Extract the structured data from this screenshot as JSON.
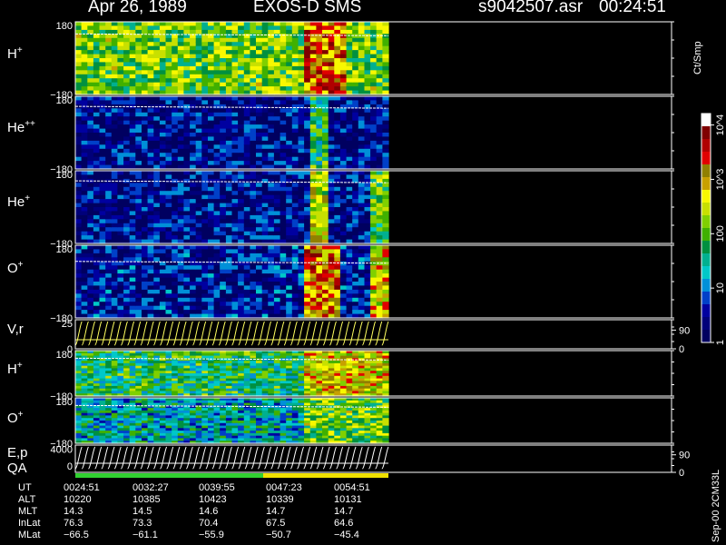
{
  "header": {
    "date": "Apr 26, 1989",
    "instrument": "EXOS-D SMS",
    "filename": "s9042507.asr",
    "time": "00:24:51"
  },
  "colorbar": {
    "unit": "Ct/Smp",
    "tick_labels": [
      {
        "text": "1",
        "value": 1
      },
      {
        "text": "10",
        "value": 10
      },
      {
        "text": "100",
        "value": 100
      },
      {
        "text": "10^3",
        "value": 1000
      },
      {
        "text": "10^4",
        "value": 10000
      }
    ],
    "colors": [
      "#000060",
      "#00007a",
      "#0000a0",
      "#0040c8",
      "#0090d8",
      "#00c8c8",
      "#00b090",
      "#009040",
      "#40b000",
      "#80d000",
      "#c8e000",
      "#f8f800",
      "#c8a000",
      "#908000",
      "#e00000",
      "#b00000",
      "#800000",
      "#ffffff"
    ]
  },
  "footer_side_text": "Sep-00 2CM33L",
  "time_table": {
    "row_labels": [
      "UT",
      "ALT",
      "MLT",
      "InLat",
      "MLat"
    ],
    "columns": [
      [
        "0024:51",
        "10220",
        "14.3",
        "76.3",
        "−66.5"
      ],
      [
        "0032:27",
        "10385",
        "14.5",
        "73.3",
        "−61.1"
      ],
      [
        "0039:55",
        "10423",
        "14.6",
        "70.4",
        "−55.9"
      ],
      [
        "0047:23",
        "10339",
        "14.7",
        "67.5",
        "−50.7"
      ],
      [
        "0054:51",
        "10131",
        "14.7",
        "64.6",
        "−45.4"
      ]
    ]
  },
  "quality_bar": [
    {
      "label": "",
      "start": 0,
      "end": 0.6,
      "color": "#30d030"
    },
    {
      "label": "",
      "start": 0.6,
      "end": 1.0,
      "color": "#f0e000"
    }
  ],
  "chart_data": [
    {
      "type": "heatmap",
      "panel": "H+ angle",
      "ylabel_main": "H",
      "ylabel_sup": "+",
      "yticks": [
        {
          "text": "180",
          "value": 180
        },
        {
          "text": "−180",
          "value": -180
        }
      ],
      "ylim": [
        -180,
        180
      ],
      "x_frac_range": [
        0,
        0.59
      ],
      "bursts": [
        {
          "start": 0.72,
          "end": 0.85,
          "level": 0.85
        }
      ],
      "base_level": 0.55,
      "line_value": 120
    },
    {
      "type": "heatmap",
      "panel": "He++ angle",
      "ylabel_main": "He",
      "ylabel_sup": "++",
      "yticks": [
        {
          "text": "180",
          "value": 180
        },
        {
          "text": "−180",
          "value": -180
        }
      ],
      "ylim": [
        -180,
        180
      ],
      "x_frac_range": [
        0,
        0.59
      ],
      "bursts": [
        {
          "start": 0.74,
          "end": 0.8,
          "level": 0.45
        }
      ],
      "base_level": 0.12,
      "line_value": 130
    },
    {
      "type": "heatmap",
      "panel": "He+ angle",
      "ylabel_main": "He",
      "ylabel_sup": "+",
      "yticks": [
        {
          "text": "180",
          "value": 180
        },
        {
          "text": "−180",
          "value": -180
        }
      ],
      "ylim": [
        -180,
        180
      ],
      "x_frac_range": [
        0,
        0.59
      ],
      "bursts": [
        {
          "start": 0.74,
          "end": 0.8,
          "level": 0.65
        },
        {
          "start": 0.93,
          "end": 0.99,
          "level": 0.5
        }
      ],
      "base_level": 0.12,
      "line_value": 130
    },
    {
      "type": "heatmap",
      "panel": "O+ angle",
      "ylabel_main": "O",
      "ylabel_sup": "+",
      "yticks": [
        {
          "text": "180",
          "value": 180
        },
        {
          "text": "−180",
          "value": -180
        }
      ],
      "ylim": [
        -180,
        180
      ],
      "x_frac_range": [
        0,
        0.59
      ],
      "bursts": [
        {
          "start": 0.73,
          "end": 0.83,
          "level": 0.8
        },
        {
          "start": 0.93,
          "end": 1.0,
          "level": 0.7
        }
      ],
      "base_level": 0.15,
      "line_value": 100
    },
    {
      "type": "line",
      "panel": "V,r",
      "ylabel_main": "V,r",
      "ylabel_sup": "",
      "yticks": [
        {
          "text": "25",
          "value": 25
        },
        {
          "text": "0",
          "value": 0
        }
      ],
      "ylim": [
        0,
        25
      ],
      "right_ticks": [
        {
          "text": "90",
          "value": 90
        },
        {
          "text": "0",
          "value": 0
        }
      ],
      "right_ylim": [
        0,
        140
      ],
      "sweeps": 48
    },
    {
      "type": "heatmap",
      "panel": "H+ energy",
      "ylabel_main": "H",
      "ylabel_sup": "+",
      "yticks": [
        {
          "text": "180",
          "value": 180
        },
        {
          "text": "−180",
          "value": -180
        }
      ],
      "ylim": [
        -180,
        180
      ],
      "x_frac_range": [
        0,
        0.59
      ],
      "bursts": [
        {
          "start": 0.72,
          "end": 1.0,
          "level": 0.7
        }
      ],
      "base_level": 0.45,
      "line_value": 120
    },
    {
      "type": "heatmap",
      "panel": "O+ energy",
      "ylabel_main": "O",
      "ylabel_sup": "+",
      "yticks": [
        {
          "text": "180",
          "value": 180
        },
        {
          "text": "−180",
          "value": -180
        }
      ],
      "ylim": [
        -180,
        180
      ],
      "x_frac_range": [
        0,
        0.59
      ],
      "bursts": [
        {
          "start": 0.72,
          "end": 1.0,
          "level": 0.55
        }
      ],
      "base_level": 0.35,
      "line_value": 120
    },
    {
      "type": "line",
      "panel": "E,p QA",
      "ylabel_main": "E,p",
      "ylabel_line2": "QA",
      "yticks": [
        {
          "text": "4000",
          "value": 4000
        },
        {
          "text": "0",
          "value": 0
        }
      ],
      "ylim": [
        -1500,
        5000
      ],
      "right_ticks": [
        {
          "text": "90",
          "value": 90
        },
        {
          "text": "0",
          "value": 0
        }
      ],
      "right_ylim": [
        0,
        140
      ],
      "sweeps": 48
    }
  ]
}
